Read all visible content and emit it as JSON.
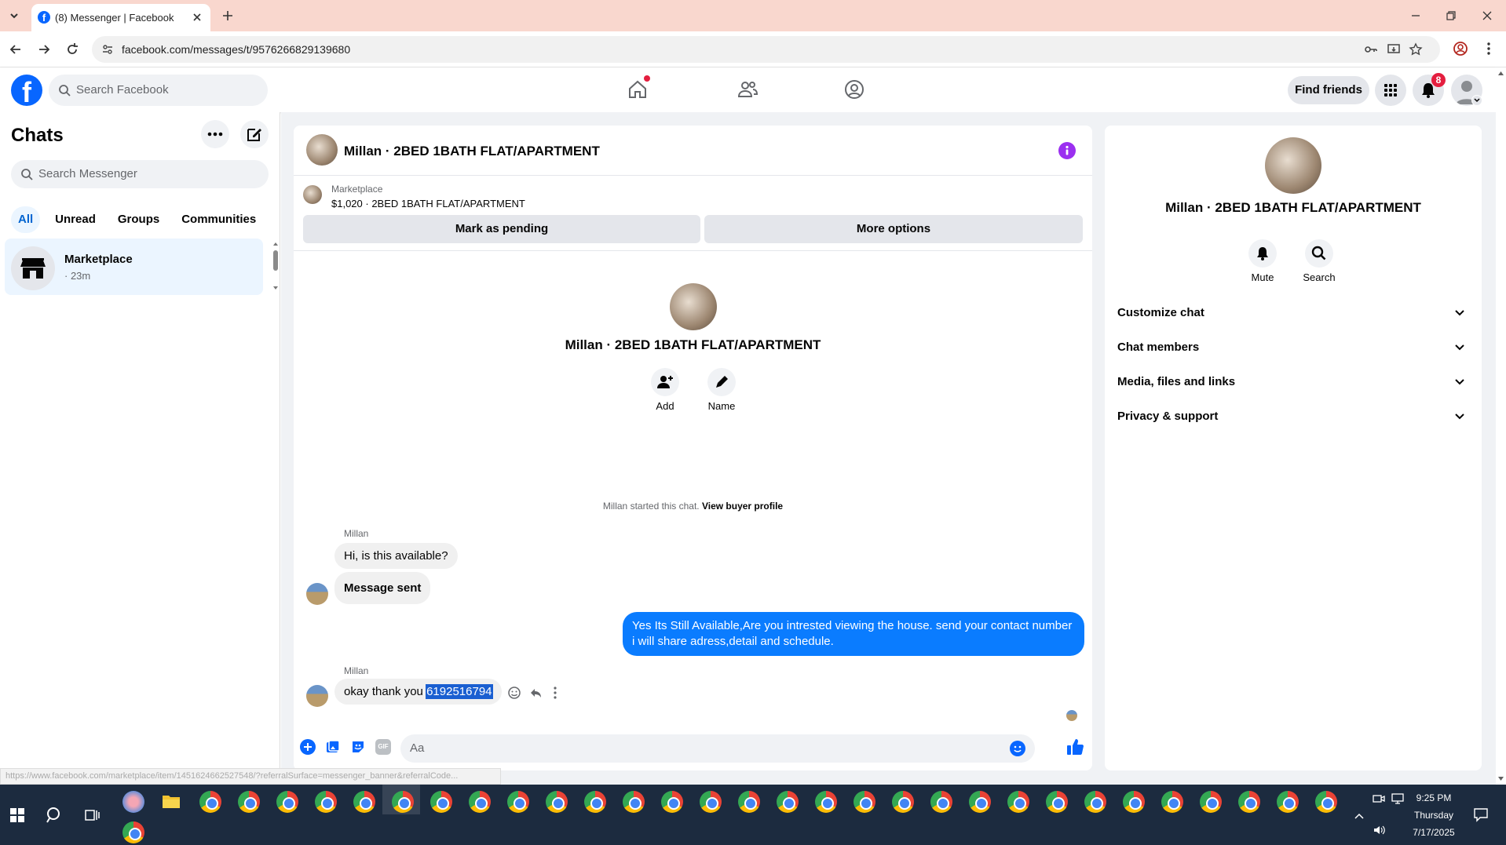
{
  "browser": {
    "tab_title": "(8) Messenger | Facebook",
    "url": "facebook.com/messages/t/9576266829139680"
  },
  "topnav": {
    "search_placeholder": "Search Facebook",
    "find_friends": "Find friends",
    "notification_count": "8"
  },
  "chats": {
    "title": "Chats",
    "search_placeholder": "Search Messenger",
    "filters": [
      "All",
      "Unread",
      "Groups",
      "Communities"
    ],
    "items": [
      {
        "name": "Marketplace",
        "time": "· 23m"
      }
    ]
  },
  "conversation": {
    "header_name": "Millan · 2BED 1BATH FLAT/APARTMENT",
    "listing_source": "Marketplace",
    "listing_title": "$1,020 · 2BED 1BATH FLAT/APARTMENT",
    "mark_pending": "Mark as pending",
    "more_options": "More options",
    "profile_name": "Millan · 2BED 1BATH FLAT/APARTMENT",
    "add_label": "Add",
    "name_label": "Name",
    "started_text": "Millan started this chat.",
    "view_profile": "View buyer profile",
    "messages": [
      {
        "sender": "Millan",
        "text": "Hi, is this available?"
      },
      {
        "text": "Message sent"
      },
      {
        "text": "Yes Its Still Available,Are you intrested viewing the house. send your contact number i will share adress,detail and schedule."
      },
      {
        "sender": "Millan",
        "text": "okay thank you ",
        "highlight": "6192516794"
      }
    ],
    "composer_placeholder": "Aa"
  },
  "info_panel": {
    "name": "Millan · 2BED 1BATH FLAT/APARTMENT",
    "mute": "Mute",
    "search": "Search",
    "sections": [
      "Customize chat",
      "Chat members",
      "Media, files and links",
      "Privacy & support"
    ]
  },
  "status_url": "https://www.facebook.com/marketplace/item/1451624662527548/?referralSurface=messenger_banner&referralCode...",
  "taskbar": {
    "time": "9:25 PM",
    "day": "Thursday",
    "date": "7/17/2025"
  },
  "colors": {
    "fb_blue": "#0866ff",
    "bubble_blue": "#0a7cff",
    "tab_bg": "#f9d7ce"
  }
}
